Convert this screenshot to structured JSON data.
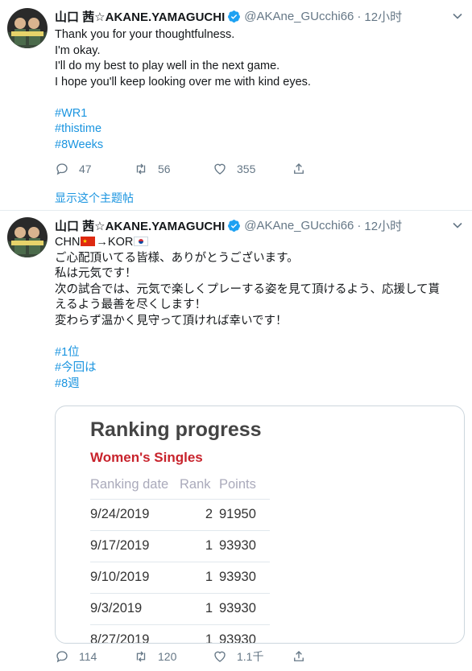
{
  "tweet1": {
    "name": "山口 茜☆AKANE.YAMAGUCHI",
    "handle": "@AKAne_GUcchi66",
    "time": "12小时",
    "lines": [
      "Thank you for your thoughtfulness.",
      "I'm okay.",
      "I'll do my best to play well in the next game.",
      "I hope you'll keep looking over me with kind eyes."
    ],
    "hashtags": [
      "#WR1",
      "#thistime",
      "#8Weeks"
    ],
    "replies": "47",
    "retweets": "56",
    "likes": "355",
    "show_thread": "显示这个主题帖"
  },
  "tweet2": {
    "name": "山口 茜☆AKANE.YAMAGUCHI",
    "handle": "@AKAne_GUcchi66",
    "time": "12小时",
    "flag_line_prefix": "CHN",
    "flag_line_mid": "→KOR",
    "lines": [
      "ご心配頂いてる皆様、ありがとうございます。",
      "私は元気です！",
      "次の試合では、元気で楽しくプレーする姿を見て頂けるよう、応援して貰",
      "えるよう最善を尽くします！",
      "変わらず温かく見守って頂ければ幸いです！"
    ],
    "hashtags": [
      "#1位",
      "#今回は",
      "#8週"
    ],
    "replies": "114",
    "retweets": "120",
    "likes": "1.1千"
  },
  "card": {
    "title": "Ranking progress",
    "subtitle": "Women's Singles",
    "headers": [
      "Ranking date",
      "Rank",
      "Points"
    ],
    "rows": [
      [
        "9/24/2019",
        "2",
        "91950"
      ],
      [
        "9/17/2019",
        "1",
        "93930"
      ],
      [
        "9/10/2019",
        "1",
        "93930"
      ],
      [
        "9/3/2019",
        "1",
        "93930"
      ],
      [
        "8/27/2019",
        "1",
        "93930"
      ]
    ]
  },
  "colors": {
    "link": "#1b95e0",
    "secondary": "#657786",
    "accent_red": "#c8232c"
  },
  "icons": [
    "verified-badge",
    "caret-down",
    "reply",
    "retweet",
    "like",
    "share"
  ]
}
